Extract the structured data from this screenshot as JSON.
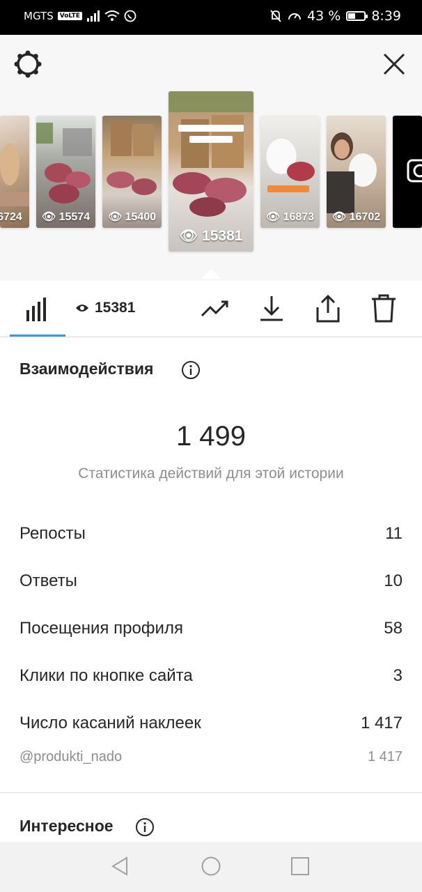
{
  "status_bar": {
    "carrier": "MGTS",
    "volte": "VoLTE",
    "battery_percent": "43 %",
    "battery_level": 0.43,
    "time": "8:39"
  },
  "stories": [
    {
      "views": "6724"
    },
    {
      "views": "15574"
    },
    {
      "views": "15400"
    },
    {
      "views": "15381",
      "active": true
    },
    {
      "views": "16873"
    },
    {
      "views": "16702"
    }
  ],
  "toolbar": {
    "views": "15381"
  },
  "interactions": {
    "title": "Взаимодействия",
    "total": "1 499",
    "subtitle": "Статистика действий для этой истории",
    "rows": [
      {
        "label": "Репосты",
        "value": "11"
      },
      {
        "label": "Ответы",
        "value": "10"
      },
      {
        "label": "Посещения профиля",
        "value": "58"
      },
      {
        "label": "Клики по кнопке сайта",
        "value": "3"
      },
      {
        "label": "Число касаний наклеек",
        "value": "1 417"
      }
    ],
    "sticker_row": {
      "label": "@produkti_nado",
      "value": "1 417"
    }
  },
  "discovery": {
    "title": "Интересное"
  },
  "colors": {
    "accent": "#3897f0",
    "text": "#262626",
    "muted": "#8e8e8e"
  }
}
